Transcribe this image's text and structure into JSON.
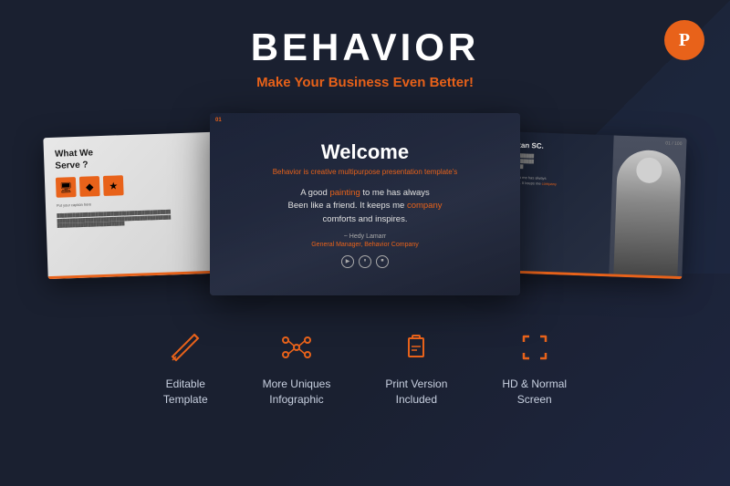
{
  "header": {
    "title": "BEHAVIOR",
    "subtitle_plain": "Make Your Business Even ",
    "subtitle_highlight": "Better!",
    "ppt_badge_label": "P"
  },
  "slides": {
    "center": {
      "slide_num": "01",
      "heading": "Welcome",
      "tagline_plain": "is creative multipurpose presentation template's",
      "tagline_brand": "Behavior",
      "quote_line1": "A good ",
      "quote_word1": "painting",
      "quote_mid1": " to me has always",
      "quote_line2": "Been like a friend. It keeps me ",
      "quote_word2": "company",
      "quote_end": "",
      "quote_line3": "comforts and inspires.",
      "author": "~ Hedy Lamarr",
      "company_label": "General Manager, Behavior Company"
    },
    "left": {
      "heading": "What We\nServe ?",
      "link_label": "Put your caption here"
    },
    "right": {
      "heading": "Manhattan SC.",
      "slide_num": "01 / 100"
    }
  },
  "features": [
    {
      "id": "editable",
      "icon": "pencil-icon",
      "label": "Editable\nTemplate"
    },
    {
      "id": "infographic",
      "icon": "nodes-icon",
      "label": "More Uniques\nInfographic"
    },
    {
      "id": "print",
      "icon": "print-icon",
      "label": "Print Version\nIncluded"
    },
    {
      "id": "screen",
      "icon": "screen-icon",
      "label": "HD & Normal\nScreen"
    }
  ]
}
